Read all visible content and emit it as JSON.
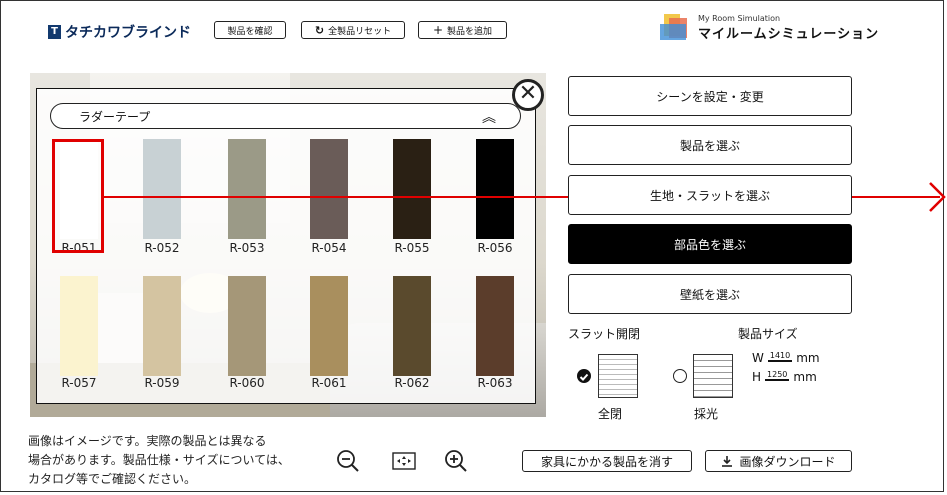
{
  "header": {
    "logo_text": "タチカワブラインド",
    "logo_mark": "T",
    "confirm_label": "製品を確認",
    "reset_label": "全製品リセット",
    "add_label": "製品を追加",
    "brand_en": "My Room Simulation",
    "brand_jp": "マイルームシミュレーション"
  },
  "panel": {
    "dropdown_label": "ラダーテープ",
    "close_glyph": "✕",
    "swatches": [
      {
        "code": "R-051",
        "color": "#ffffff"
      },
      {
        "code": "R-052",
        "color": "#c8d1d4"
      },
      {
        "code": "R-053",
        "color": "#9b9a87"
      },
      {
        "code": "R-054",
        "color": "#6a5c58"
      },
      {
        "code": "R-055",
        "color": "#2a2014"
      },
      {
        "code": "R-056",
        "color": "#000000"
      },
      {
        "code": "R-057",
        "color": "#fbf3cf"
      },
      {
        "code": "R-059",
        "color": "#d4c4a1"
      },
      {
        "code": "R-060",
        "color": "#a59778"
      },
      {
        "code": "R-061",
        "color": "#a98f5e"
      },
      {
        "code": "R-062",
        "color": "#5a4a2d"
      },
      {
        "code": "R-063",
        "color": "#5b3d2b"
      }
    ],
    "selected_code": "R-051"
  },
  "menu": {
    "scene_label": "シーンを設定・変更",
    "product_label": "製品を選ぶ",
    "fabric_label": "生地・スラットを選ぶ",
    "parts_label": "部品色を選ぶ",
    "wallpaper_label": "壁紙を選ぶ"
  },
  "options": {
    "slat_title": "スラット開閉",
    "size_title": "製品サイズ",
    "closed_label": "全閉",
    "light_label": "採光",
    "width_prefix": "W",
    "width_value": "1410",
    "height_prefix": "H",
    "height_value": "1250",
    "unit": "mm"
  },
  "footer": {
    "note_line1": "画像はイメージです。実際の製品とは異なる",
    "note_line2": "場合があります。製品仕様・サイズについては、",
    "note_line3": "カタログ等でご確認ください。",
    "clear_furniture_label": "家具にかかる製品を消す",
    "download_label": "画像ダウンロード"
  },
  "colors": {
    "accent_red": "#e00000",
    "selected_button_bg": "#000000"
  }
}
